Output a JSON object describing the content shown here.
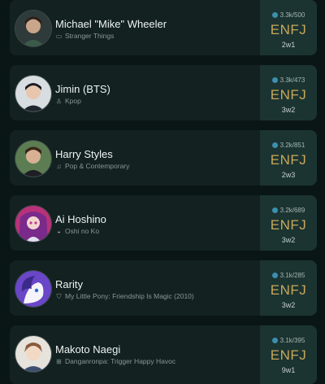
{
  "characters": [
    {
      "name": "Michael \"Mike\" Wheeler",
      "category": "Stranger Things",
      "category_icon": "tv-icon",
      "votes": "3.3k/500",
      "mbti": "ENFJ",
      "enneagram": "2w1",
      "avatar_color": "#3b3f3f"
    },
    {
      "name": "Jimin (BTS)",
      "category": "Kpop",
      "category_icon": "microphone-icon",
      "votes": "3.3k/473",
      "mbti": "ENFJ",
      "enneagram": "3w2",
      "avatar_color": "#1d2b3a"
    },
    {
      "name": "Harry Styles",
      "category": "Pop & Contemporary",
      "category_icon": "music-note-icon",
      "votes": "3.2k/851",
      "mbti": "ENFJ",
      "enneagram": "2w3",
      "avatar_color": "#4b6a45"
    },
    {
      "name": "Ai Hoshino",
      "category": "Oshi no Ko",
      "category_icon": "anime-icon",
      "votes": "3.2k/689",
      "mbti": "ENFJ",
      "enneagram": "3w2",
      "avatar_color": "#8a2a6a"
    },
    {
      "name": "Rarity",
      "category": "My Little Pony: Friendship Is Magic (2010)",
      "category_icon": "shield-icon",
      "votes": "3.1k/285",
      "mbti": "ENFJ",
      "enneagram": "3w2",
      "avatar_color": "#6a3fb8"
    },
    {
      "name": "Makoto Naegi",
      "category": "Danganronpa: Trigger Happy Havoc",
      "category_icon": "gamepad-icon",
      "votes": "3.1k/395",
      "mbti": "ENFJ",
      "enneagram": "9w1",
      "avatar_color": "#d9d4cc"
    }
  ],
  "colors": {
    "background": "#0a1616",
    "card": "#132121",
    "type_panel": "#1b3431",
    "mbti_gold": "#c9a75b",
    "vote_blue": "#3c8fb0"
  }
}
